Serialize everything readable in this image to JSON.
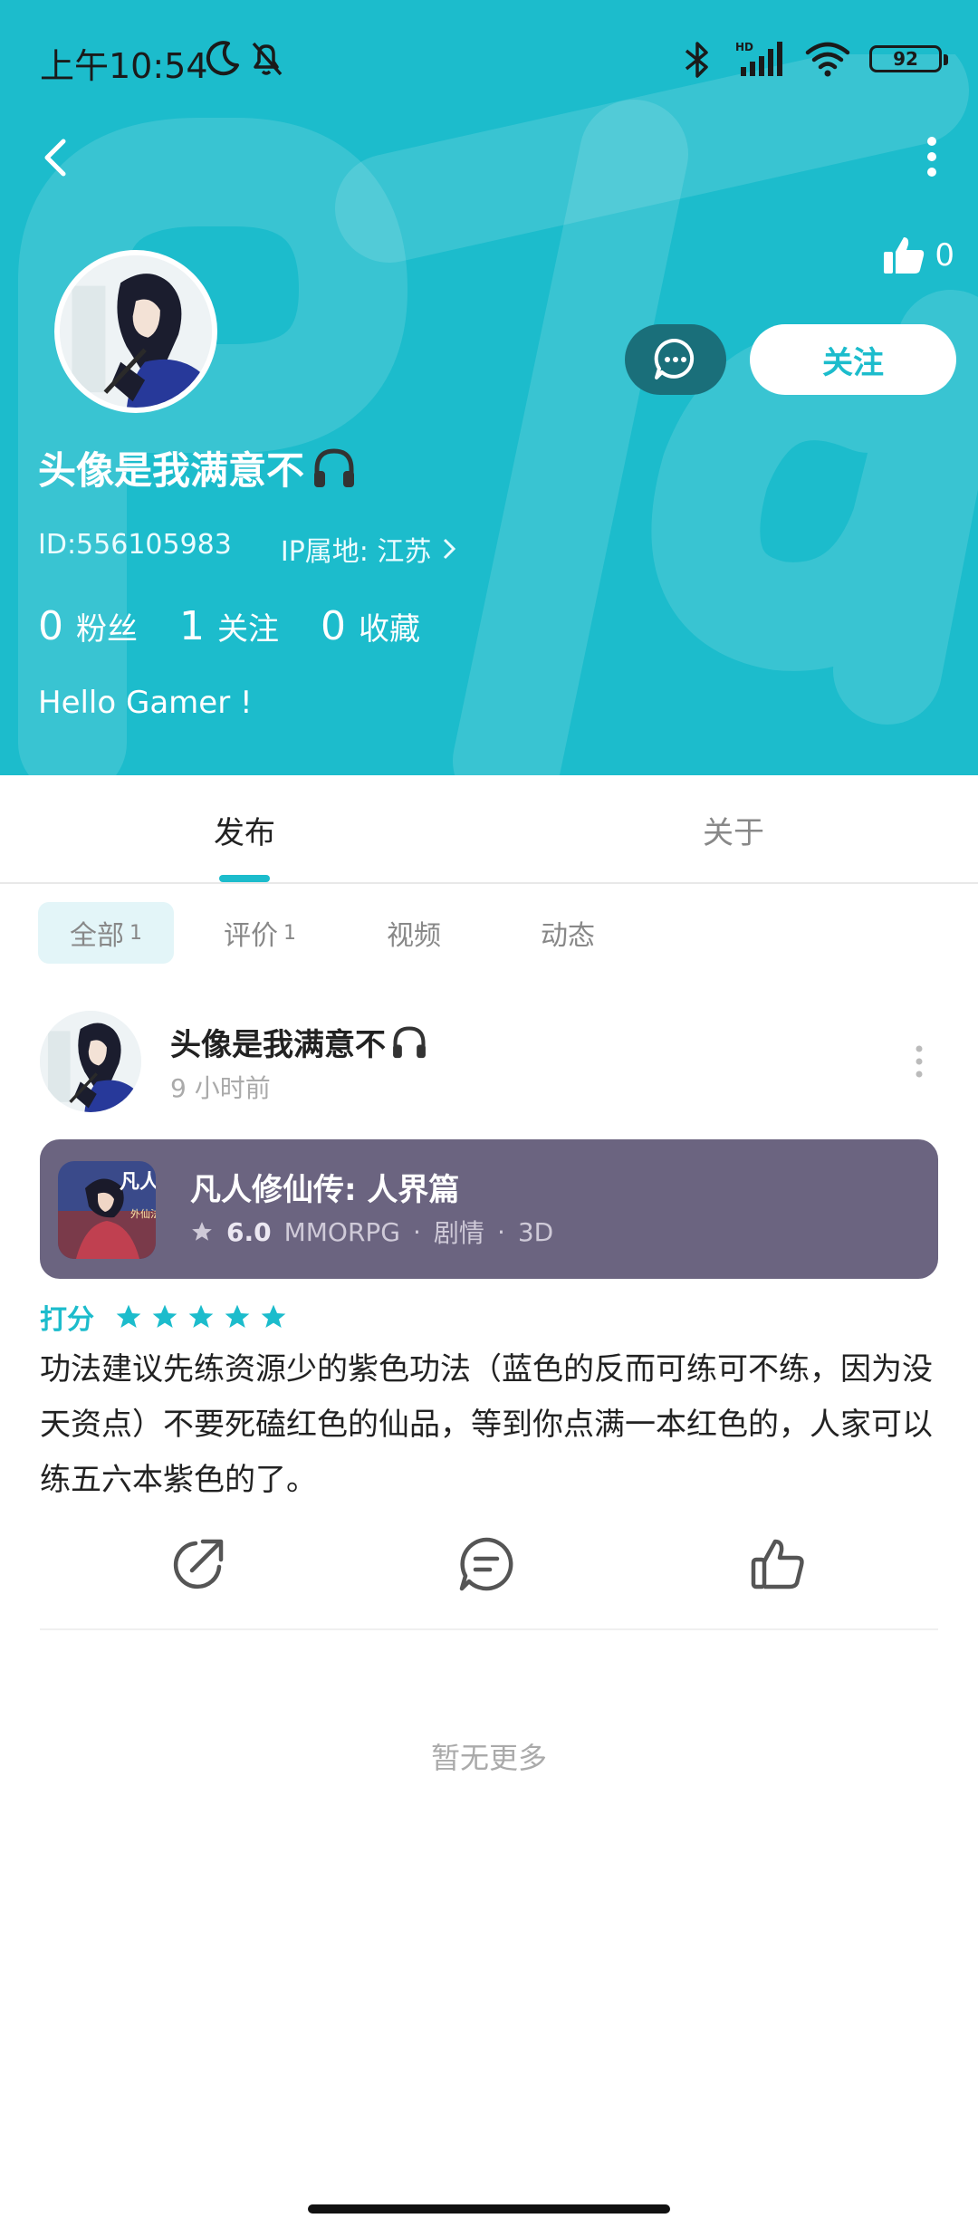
{
  "status_bar": {
    "time": "上午10:54",
    "battery": "92"
  },
  "header": {
    "like_count": "0",
    "follow_label": "关注",
    "nickname": "头像是我满意不",
    "id_text": "ID:556105983",
    "ip_text": "IP属地: 江苏",
    "stats": [
      {
        "num": "0",
        "label": "粉丝"
      },
      {
        "num": "1",
        "label": "关注"
      },
      {
        "num": "0",
        "label": "收藏"
      }
    ],
    "bio": "Hello Gamer !"
  },
  "tabs": [
    {
      "label": "发布"
    },
    {
      "label": "关于"
    }
  ],
  "filters": [
    {
      "label": "全部",
      "count": "1"
    },
    {
      "label": "评价",
      "count": "1"
    },
    {
      "label": "视频",
      "count": ""
    },
    {
      "label": "动态",
      "count": ""
    }
  ],
  "post": {
    "author": "头像是我满意不",
    "time": "9 小时前",
    "game": {
      "title": "凡人修仙传: 人界篇",
      "score": "6.0",
      "tags": [
        "MMORPG",
        "剧情",
        "3D"
      ],
      "icon_text": "凡人",
      "icon_subtext": "外仙法"
    },
    "rating_label": "打分",
    "stars": 5,
    "review": "功法建议先练资源少的紫色功法（蓝色的反而可练可不练，因为没天资点）不要死磕红色的仙品，等到你点满一本红色的，人家可以练五六本紫色的了。"
  },
  "footer": {
    "no_more": "暂无更多"
  },
  "colors": {
    "accent": "#1cbccc",
    "card": "#6b6480",
    "msg_button": "#1a6f7a"
  }
}
